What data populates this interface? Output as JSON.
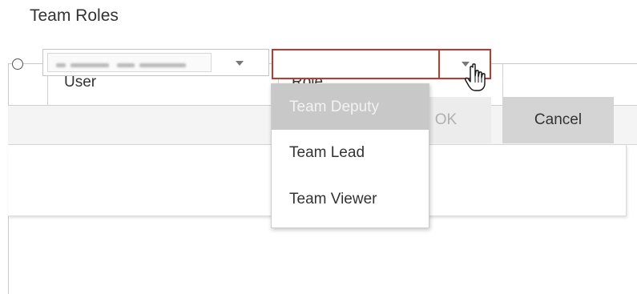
{
  "section": {
    "title": "Team Roles"
  },
  "table": {
    "columns": [
      {
        "label": "User"
      },
      {
        "label": "Role"
      }
    ]
  },
  "edit_row": {
    "user_select": {
      "value": ""
    },
    "role_select": {
      "value": "",
      "state": "error"
    }
  },
  "actions": {
    "ok_label": "OK",
    "cancel_label": "Cancel"
  },
  "role_dropdown": {
    "options": [
      {
        "label": "Team Deputy",
        "highlighted": true
      },
      {
        "label": "Team Lead",
        "highlighted": false
      },
      {
        "label": "Team Viewer",
        "highlighted": false
      }
    ]
  },
  "colors": {
    "error_border": "#c0392b",
    "highlight_bg": "#c8c8c8",
    "cancel_bg": "#d4d4d4",
    "ok_bg": "#ececec"
  },
  "icons": {
    "user_caret": "chevron-down-icon",
    "role_caret": "chevron-down-icon",
    "cursor": "hand-pointer-icon"
  }
}
